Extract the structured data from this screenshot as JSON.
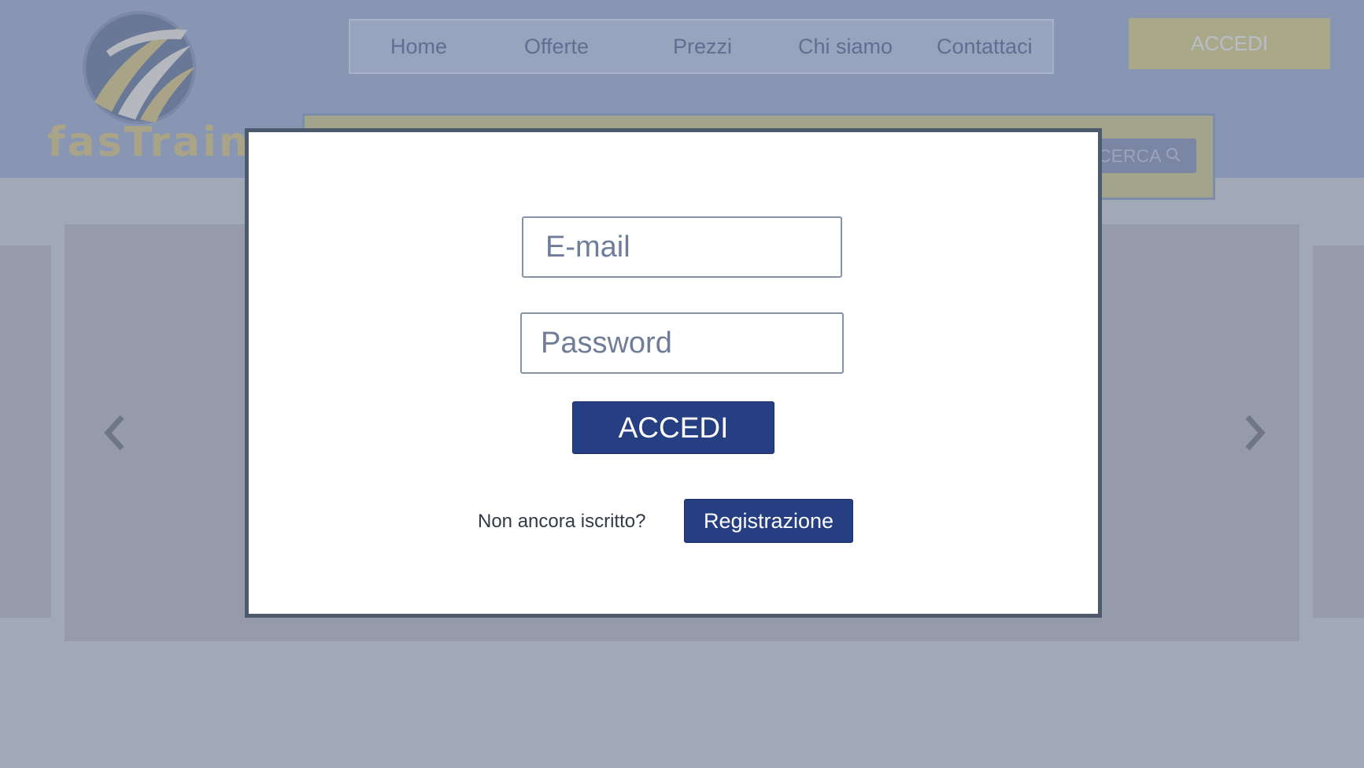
{
  "brand": {
    "logo_text": "fasTrain"
  },
  "nav": {
    "items": [
      {
        "label": "Home"
      },
      {
        "label": "Offerte"
      },
      {
        "label": "Prezzi"
      },
      {
        "label": "Chi siamo"
      },
      {
        "label": "Contattaci"
      }
    ]
  },
  "header": {
    "login_label": "ACCEDI"
  },
  "search": {
    "button_label": "CERCA",
    "button_icon": "search-icon"
  },
  "carousel": {
    "prev_icon": "chevron-left-icon",
    "next_icon": "chevron-right-icon"
  },
  "login_modal": {
    "email_placeholder": "E-mail",
    "password_placeholder": "Password",
    "submit_label": "ACCEDI",
    "signup_prompt": "Non ancora iscritto?",
    "register_label": "Registrazione"
  },
  "colors": {
    "primary_button": "#263e82",
    "overlay_header": "#8896b3",
    "overlay_body": "#a2a9b6",
    "modal_border": "#4d5a6c",
    "input_text": "#6f7d99"
  }
}
